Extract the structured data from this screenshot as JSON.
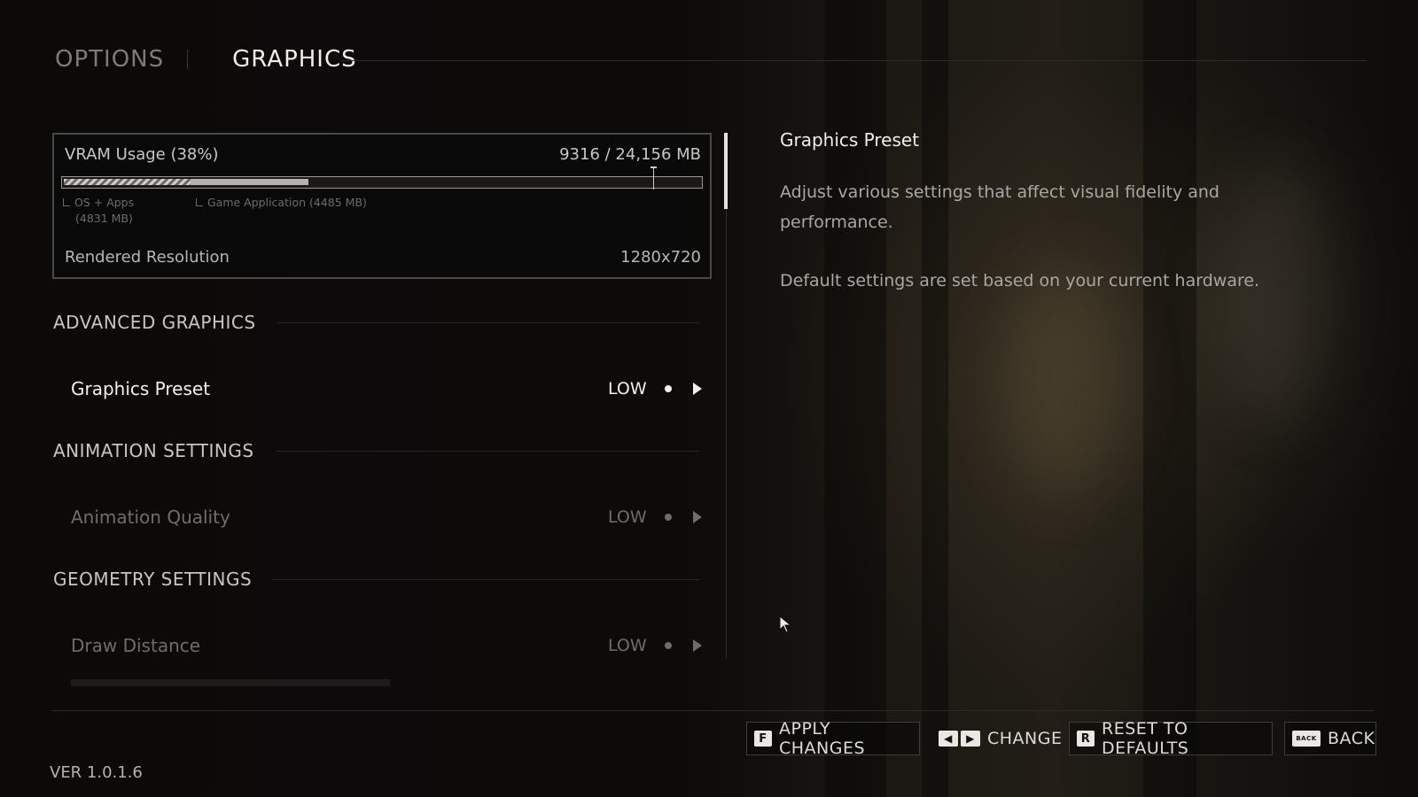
{
  "header": {
    "tabs": [
      {
        "label": "OPTIONS",
        "active": false
      },
      {
        "label": "GRAPHICS",
        "active": true
      }
    ]
  },
  "vram": {
    "title": "VRAM Usage (38%)",
    "value_text": "9316 / 24,156 MB",
    "os_label_line1": "OS + Apps",
    "os_label_line2": "(4831 MB)",
    "game_label": "Game Application (4485 MB)",
    "used_fraction": 0.38,
    "os_fraction": 0.2,
    "game_fraction": 0.186,
    "marker_fraction": 0.93,
    "resolution_label": "Rendered Resolution",
    "resolution_value": "1280x720"
  },
  "sections": [
    {
      "title": "ADVANCED GRAPHICS"
    },
    {
      "title": "ANIMATION SETTINGS"
    },
    {
      "title": "GEOMETRY SETTINGS"
    }
  ],
  "settings": [
    {
      "label": "Graphics Preset",
      "value": "LOW",
      "selected": true
    },
    {
      "label": "Animation Quality",
      "value": "LOW",
      "selected": false
    },
    {
      "label": "Draw Distance",
      "value": "LOW",
      "selected": false
    }
  ],
  "description": {
    "title": "Graphics Preset",
    "paragraph1": "Adjust various settings that affect visual fidelity and performance.",
    "paragraph2": "Default settings are set based on your current hardware."
  },
  "footer": {
    "version": "VER 1.0.1.6",
    "apply": {
      "key": "F",
      "label": "APPLY CHANGES"
    },
    "change": {
      "key_left": "◀",
      "key_right": "▶",
      "label": "CHANGE"
    },
    "reset": {
      "key": "R",
      "label": "RESET TO DEFAULTS"
    },
    "back": {
      "key": "BACK",
      "label": "BACK"
    }
  },
  "colors": {
    "accent": "#f2f0ec",
    "dim_text": "#6f6d6a",
    "background": "#0b0a09"
  },
  "icons": {
    "cursor": "mouse-pointer-icon",
    "next": "arrow-right-icon",
    "indicator": "dot-icon"
  }
}
